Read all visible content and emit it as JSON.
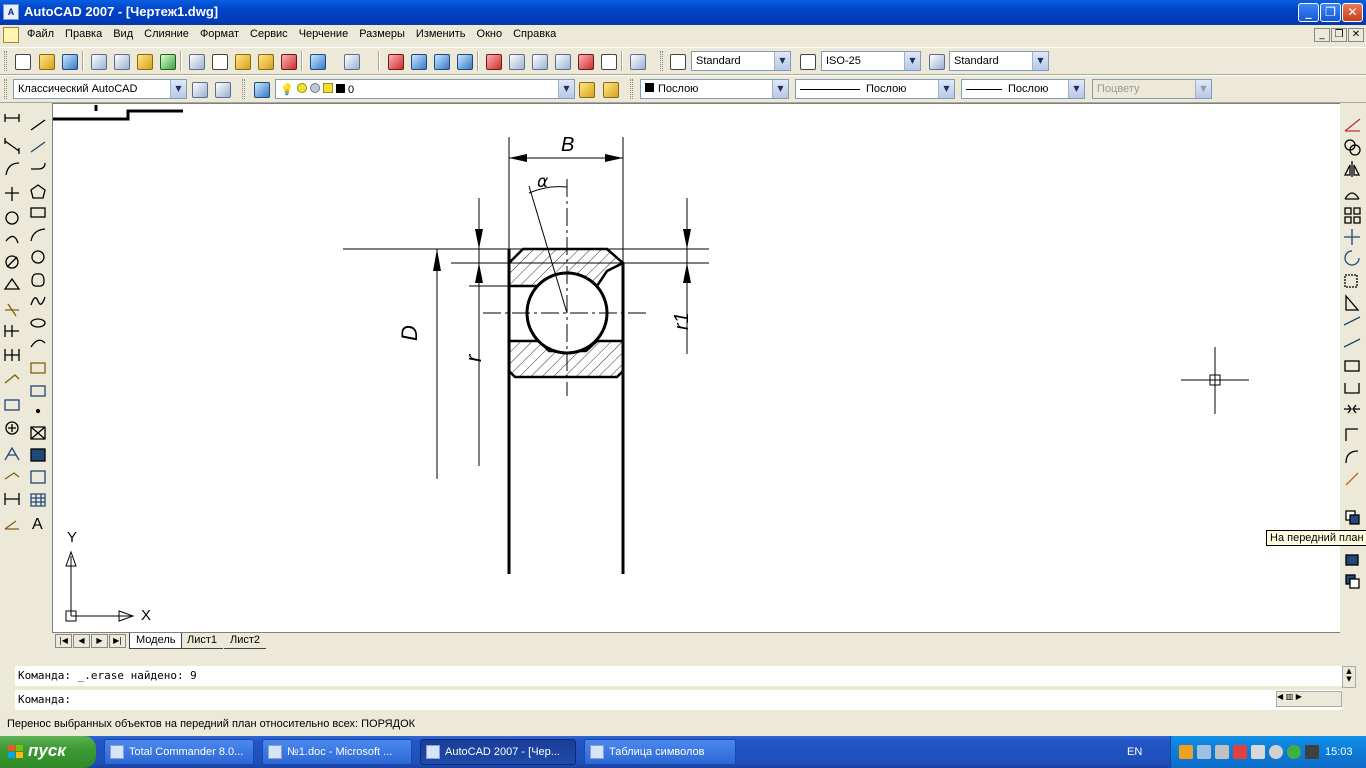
{
  "window": {
    "app_icon": "autocad-icon",
    "title": "AutoCAD 2007 - [Чертеж1.dwg]",
    "controls": [
      "minimize-icon",
      "maximize-icon",
      "close-icon"
    ]
  },
  "menu": {
    "items": [
      "Файл",
      "Правка",
      "Вид",
      "Слияние",
      "Формат",
      "Сервис",
      "Черчение",
      "Размеры",
      "Изменить",
      "Окно",
      "Справка"
    ]
  },
  "toolbars": {
    "text_style": "Standard",
    "dim_style": "ISO-25",
    "table_style": "Standard",
    "workspace": "Классический AutoCAD",
    "layer": "0",
    "color": "Послою",
    "linetype": "Послою",
    "lineweight": "Послою",
    "plotstyle": "Поцвету"
  },
  "drawing": {
    "labels": {
      "b": "B",
      "alpha": "α",
      "d": "D",
      "r": "r",
      "r1": "r1"
    },
    "ucs": {
      "x_label": "X",
      "y_label": "Y"
    }
  },
  "layout_tabs": {
    "items": [
      "Модель",
      "Лист1",
      "Лист2"
    ],
    "active": "Модель"
  },
  "command": {
    "history": "Команда: _.erase найдено: 9",
    "prompt": "Команда:"
  },
  "status": {
    "text": "Перенос выбранных объектов на передний план относительно всех: ПОРЯДОК"
  },
  "tooltip": {
    "text": "На передний план"
  },
  "taskbar": {
    "start_label": "пуск",
    "tasks": [
      {
        "label": "Total Commander 8.0...",
        "active": false
      },
      {
        "label": "№1.doc - Microsoft ...",
        "active": false
      },
      {
        "label": "AutoCAD 2007 - [Чер...",
        "active": true
      },
      {
        "label": "Таблица символов",
        "active": false
      }
    ],
    "lang": "EN",
    "clock": "15:03"
  },
  "colors": {
    "title_bar": "#0042c8",
    "taskbar": "#245edb",
    "start_button": "#3c9a34",
    "tray": "#0d7bd8",
    "tooltip_bg": "#ffffe1"
  }
}
